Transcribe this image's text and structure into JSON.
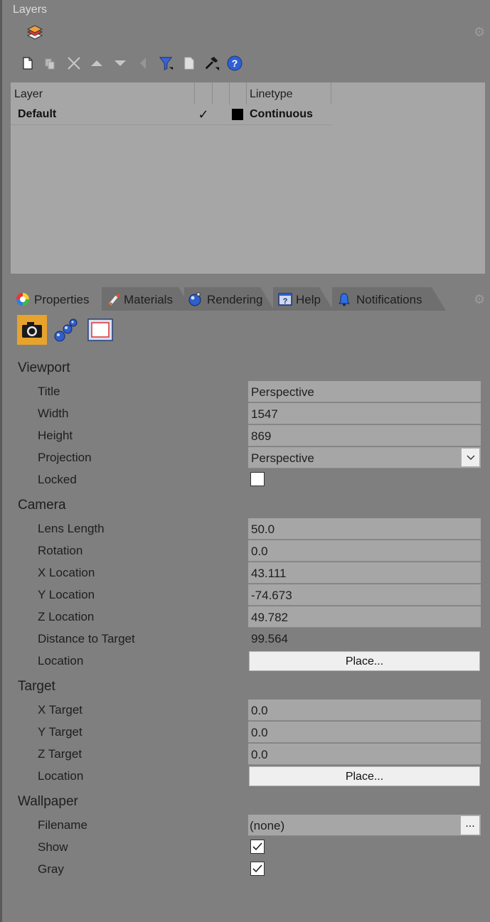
{
  "panel_title": "Layers",
  "toolbar_icons": [
    "layers-icon",
    "new-layer-icon",
    "new-sublayer-icon",
    "delete-icon",
    "move-up-icon",
    "move-down-icon",
    "move-left-icon",
    "filter-icon",
    "page-icon",
    "tools-icon",
    "help-icon"
  ],
  "layer_table": {
    "columns": [
      "Layer",
      "",
      "",
      "Linetype"
    ],
    "rows": [
      {
        "name": "Default",
        "current": "✓",
        "color": "#000000",
        "linetype": "Continuous"
      }
    ]
  },
  "tabs": [
    {
      "label": "Properties",
      "icon": "color-wheel-icon",
      "active": true
    },
    {
      "label": "Materials",
      "icon": "brush-icon",
      "active": false
    },
    {
      "label": "Rendering",
      "icon": "teapot-icon",
      "active": false
    },
    {
      "label": "Help",
      "icon": "help-icon",
      "active": false
    },
    {
      "label": "Notifications",
      "icon": "bell-icon",
      "active": false
    }
  ],
  "sub_icons": [
    "camera-icon",
    "spheres-icon",
    "viewport-frame-icon"
  ],
  "viewport": {
    "heading": "Viewport",
    "title_label": "Title",
    "title_value": "Perspective",
    "width_label": "Width",
    "width_value": "1547",
    "height_label": "Height",
    "height_value": "869",
    "projection_label": "Projection",
    "projection_value": "Perspective",
    "locked_label": "Locked",
    "locked": false
  },
  "camera": {
    "heading": "Camera",
    "lens_label": "Lens Length",
    "lens_value": "50.0",
    "rotation_label": "Rotation",
    "rotation_value": "0.0",
    "x_label": "X Location",
    "x_value": "43.111",
    "y_label": "Y Location",
    "y_value": "-74.673",
    "z_label": "Z Location",
    "z_value": "49.782",
    "distance_label": "Distance to Target",
    "distance_value": "99.564",
    "location_label": "Location",
    "place_button": "Place..."
  },
  "target": {
    "heading": "Target",
    "x_label": "X Target",
    "x_value": "0.0",
    "y_label": "Y Target",
    "y_value": "0.0",
    "z_label": "Z Target",
    "z_value": "0.0",
    "location_label": "Location",
    "place_button": "Place..."
  },
  "wallpaper": {
    "heading": "Wallpaper",
    "filename_label": "Filename",
    "filename_value": "(none)",
    "browse_button": "...",
    "show_label": "Show",
    "show": true,
    "gray_label": "Gray",
    "gray": true
  }
}
